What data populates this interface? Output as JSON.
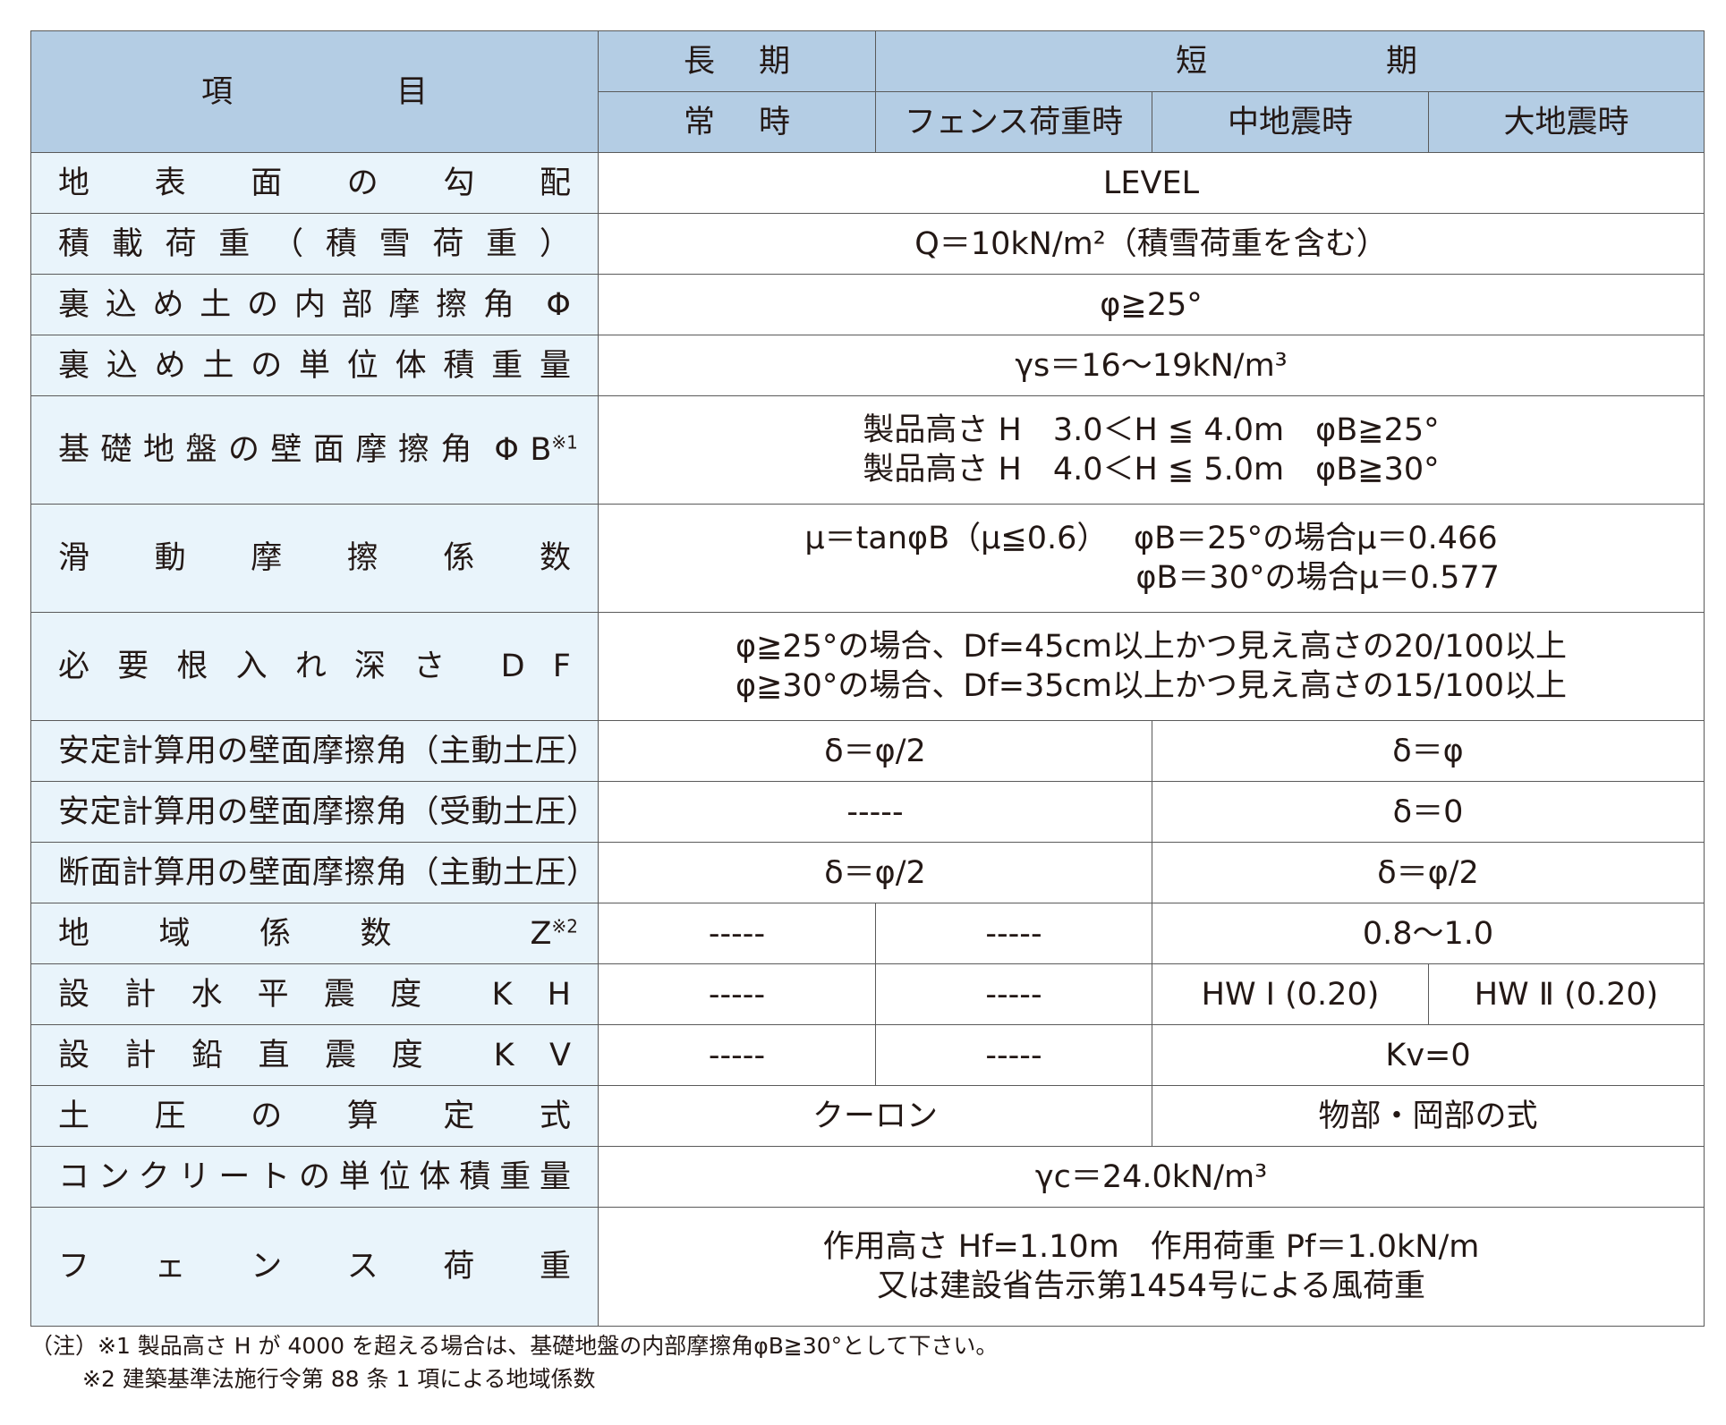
{
  "header": {
    "item": [
      "項",
      "目"
    ],
    "long_term": [
      "長",
      "期"
    ],
    "short_term": [
      "短",
      "期"
    ],
    "normal": [
      "常",
      "時"
    ],
    "fence_load": "フェンス荷重時",
    "mid_quake": "中地震時",
    "large_quake": "大地震時"
  },
  "rows": {
    "slope": {
      "label": [
        "地",
        "表",
        "面",
        "の",
        "勾",
        "配"
      ],
      "value": "LEVEL"
    },
    "surcharge": {
      "label": [
        "積",
        "載",
        "荷",
        "重",
        "（",
        "積",
        "雪",
        "荷",
        "重",
        "）"
      ],
      "value": "Q＝10kN/m²（積雪荷重を含む）"
    },
    "backfill_friction": {
      "label": [
        "裏",
        "込",
        "め",
        "土",
        "の",
        "内",
        "部",
        "摩",
        "擦",
        "角",
        "",
        "Φ"
      ],
      "value": "φ≧25°"
    },
    "backfill_weight": {
      "label": [
        "裏",
        "込",
        "め",
        "土",
        "の",
        "単",
        "位",
        "体",
        "積",
        "重",
        "量"
      ],
      "value": "γs＝16〜19kN/m³"
    },
    "base_friction": {
      "label": [
        "基",
        "礎",
        "地",
        "盤",
        "の",
        "壁",
        "面",
        "摩",
        "擦",
        "角",
        "",
        "Φ",
        "B"
      ],
      "note_mark": "※1",
      "lines": [
        "製品高さ H　3.0＜H ≦ 4.0m　φB≧25°",
        "製品高さ H　4.0＜H ≦ 5.0m　φB≧30°"
      ]
    },
    "sliding": {
      "label": [
        "滑",
        "動",
        "摩",
        "擦",
        "係",
        "数"
      ],
      "lines": [
        "μ＝tanφB（μ≦0.6）　 φB＝25°の場合μ＝0.466",
        "　　　　　　　　　　  φB＝30°の場合μ＝0.577"
      ]
    },
    "embedment": {
      "label": [
        "必",
        "要",
        "根",
        "入",
        "れ",
        "深",
        "さ",
        "",
        "D",
        "F"
      ],
      "lines": [
        "φ≧25°の場合、Df=45cm以上かつ見え高さの20/100以上",
        "φ≧30°の場合、Df=35cm以上かつ見え高さの15/100以上"
      ]
    },
    "stability_active": {
      "label": "安定計算用の壁面摩擦角（主動土圧）",
      "long": "δ＝φ/2",
      "short": "δ＝φ"
    },
    "stability_passive": {
      "label": "安定計算用の壁面摩擦角（受動土圧）",
      "long": "-----",
      "short": "δ＝0"
    },
    "section_active": {
      "label": "断面計算用の壁面摩擦角（主動土圧）",
      "long": "δ＝φ/2",
      "short": "δ＝φ/2"
    },
    "zone": {
      "label": [
        "地",
        "域",
        "係",
        "数",
        "Z"
      ],
      "note_mark": "※2",
      "normal": "-----",
      "fence": "-----",
      "quake": "0.8〜1.0"
    },
    "kh": {
      "label": [
        "設",
        "計",
        "水",
        "平",
        "震",
        "度",
        "",
        "K",
        "H"
      ],
      "normal": "-----",
      "fence": "-----",
      "mid": "HW Ⅰ (0.20)",
      "large": "HW Ⅱ (0.20)"
    },
    "kv": {
      "label": [
        "設",
        "計",
        "鉛",
        "直",
        "震",
        "度",
        "",
        "K",
        "V"
      ],
      "normal": "-----",
      "fence": "-----",
      "quake": "Kv=0"
    },
    "earth_pressure": {
      "label": [
        "土",
        "圧",
        "の",
        "算",
        "定",
        "式"
      ],
      "long": "クーロン",
      "short": "物部・岡部の式"
    },
    "concrete_weight": {
      "label": [
        "コ",
        "ン",
        "ク",
        "リ",
        "ー",
        "ト",
        "の",
        "単",
        "位",
        "体",
        "積",
        "重",
        "量"
      ],
      "value": "γc＝24.0kN/m³"
    },
    "fence": {
      "label": [
        "フ",
        "ェ",
        "ン",
        "ス",
        "荷",
        "重"
      ],
      "lines": [
        "作用高さ Hf=1.10m　作用荷重 Pf＝1.0kN/m",
        "又は建設省告示第1454号による風荷重"
      ]
    }
  },
  "notes": [
    "（注）※1 製品高さ H が 4000 を超える場合は、基礎地盤の内部摩擦角φB≧30°として下さい。",
    "※2 建築基準法施行令第 88 条 1 項による地域係数"
  ],
  "colors": {
    "header_bg": "#b4cde4",
    "label_bg": "#e9f4fb",
    "value_bg": "#ffffff",
    "border": "#5a5a5a"
  }
}
